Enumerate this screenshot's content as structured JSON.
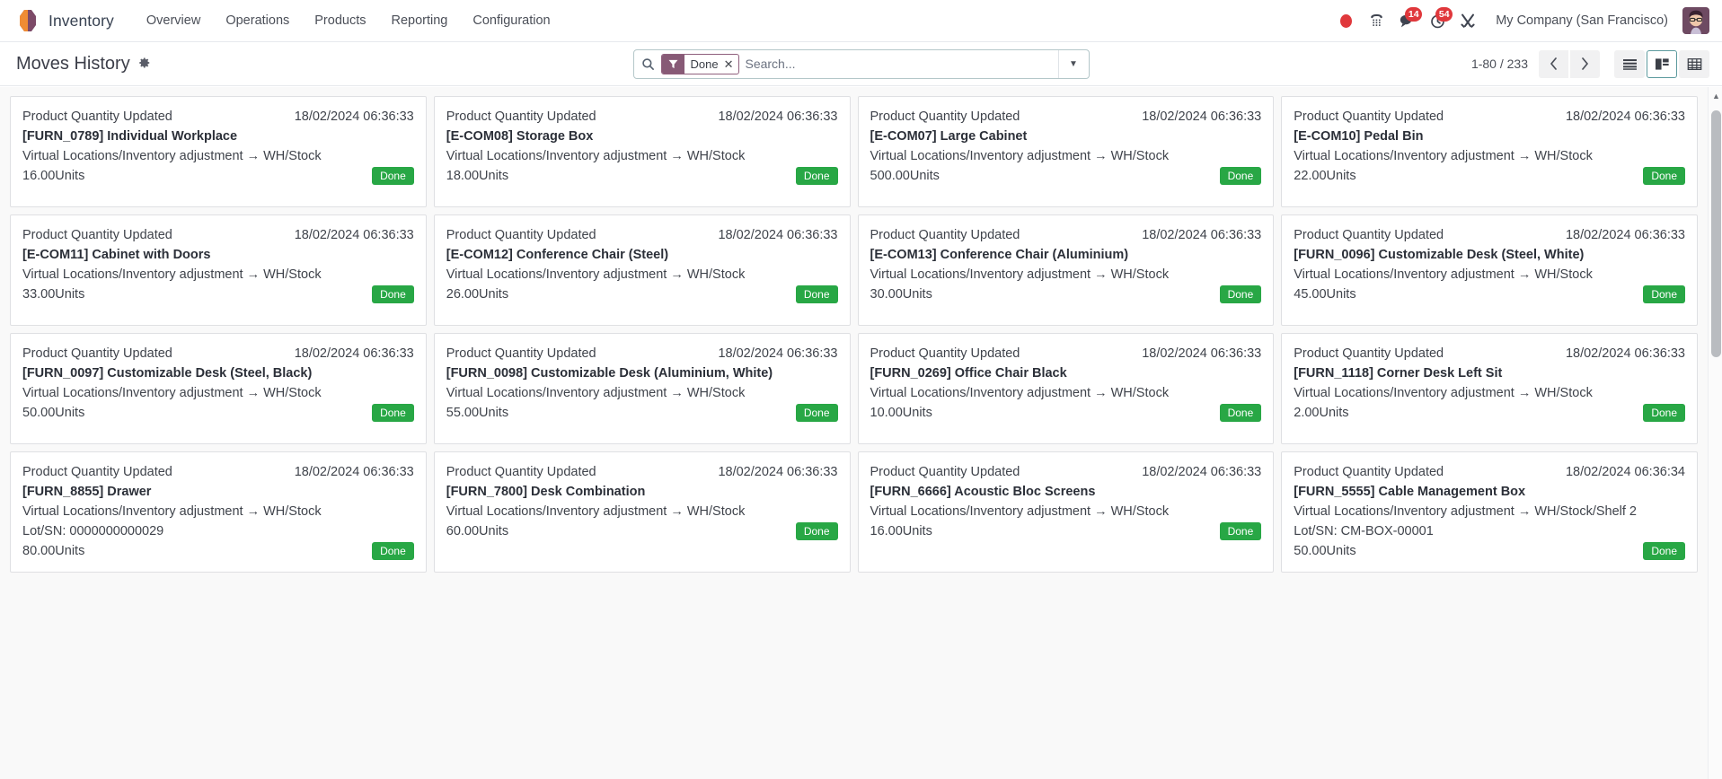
{
  "navbar": {
    "brand": "Inventory",
    "menu": [
      "Overview",
      "Operations",
      "Products",
      "Reporting",
      "Configuration"
    ],
    "icons": {
      "record": "record-dot-icon",
      "phone": "phone-icon",
      "messages": "messages-icon",
      "activities": "clock-icon",
      "debug": "wrench-icon"
    },
    "messages_count": "14",
    "activities_count": "54",
    "company": "My Company (San Francisco)"
  },
  "control_panel": {
    "title": "Moves History",
    "gear": "gear-icon",
    "search": {
      "facet_label": "Done",
      "facet_icon": "filter-icon",
      "placeholder": "Search...",
      "value": ""
    },
    "pager": "1-80 / 233",
    "prev": "‹",
    "next": "›",
    "views": [
      {
        "name": "list",
        "label": "list-view",
        "active": false
      },
      {
        "name": "kanban",
        "label": "kanban-view",
        "active": true
      },
      {
        "name": "pivot",
        "label": "pivot-view",
        "active": false
      }
    ]
  },
  "colors": {
    "accent": "#875A76",
    "badge_done": "#28a745",
    "badge_counter": "#e0383c",
    "kanban_bg": "#f9f9f9"
  },
  "cards": [
    {
      "type": "Product Quantity Updated",
      "date": "18/02/2024 06:36:33",
      "product": "[FURN_0789] Individual Workplace",
      "route": "Virtual Locations/Inventory adjustment → WH/Stock",
      "lot": "",
      "qty": "16.00Units",
      "state": "Done"
    },
    {
      "type": "Product Quantity Updated",
      "date": "18/02/2024 06:36:33",
      "product": "[E-COM08] Storage Box",
      "route": "Virtual Locations/Inventory adjustment → WH/Stock",
      "lot": "",
      "qty": "18.00Units",
      "state": "Done"
    },
    {
      "type": "Product Quantity Updated",
      "date": "18/02/2024 06:36:33",
      "product": "[E-COM07] Large Cabinet",
      "route": "Virtual Locations/Inventory adjustment → WH/Stock",
      "lot": "",
      "qty": "500.00Units",
      "state": "Done"
    },
    {
      "type": "Product Quantity Updated",
      "date": "18/02/2024 06:36:33",
      "product": "[E-COM10] Pedal Bin",
      "route": "Virtual Locations/Inventory adjustment → WH/Stock",
      "lot": "",
      "qty": "22.00Units",
      "state": "Done"
    },
    {
      "type": "Product Quantity Updated",
      "date": "18/02/2024 06:36:33",
      "product": "[E-COM11] Cabinet with Doors",
      "route": "Virtual Locations/Inventory adjustment → WH/Stock",
      "lot": "",
      "qty": "33.00Units",
      "state": "Done"
    },
    {
      "type": "Product Quantity Updated",
      "date": "18/02/2024 06:36:33",
      "product": "[E-COM12] Conference Chair (Steel)",
      "route": "Virtual Locations/Inventory adjustment → WH/Stock",
      "lot": "",
      "qty": "26.00Units",
      "state": "Done"
    },
    {
      "type": "Product Quantity Updated",
      "date": "18/02/2024 06:36:33",
      "product": "[E-COM13] Conference Chair (Aluminium)",
      "route": "Virtual Locations/Inventory adjustment → WH/Stock",
      "lot": "",
      "qty": "30.00Units",
      "state": "Done"
    },
    {
      "type": "Product Quantity Updated",
      "date": "18/02/2024 06:36:33",
      "product": "[FURN_0096] Customizable Desk (Steel, White)",
      "route": "Virtual Locations/Inventory adjustment → WH/Stock",
      "lot": "",
      "qty": "45.00Units",
      "state": "Done"
    },
    {
      "type": "Product Quantity Updated",
      "date": "18/02/2024 06:36:33",
      "product": "[FURN_0097] Customizable Desk (Steel, Black)",
      "route": "Virtual Locations/Inventory adjustment → WH/Stock",
      "lot": "",
      "qty": "50.00Units",
      "state": "Done"
    },
    {
      "type": "Product Quantity Updated",
      "date": "18/02/2024 06:36:33",
      "product": "[FURN_0098] Customizable Desk (Aluminium, White)",
      "route": "Virtual Locations/Inventory adjustment → WH/Stock",
      "lot": "",
      "qty": "55.00Units",
      "state": "Done"
    },
    {
      "type": "Product Quantity Updated",
      "date": "18/02/2024 06:36:33",
      "product": "[FURN_0269] Office Chair Black",
      "route": "Virtual Locations/Inventory adjustment → WH/Stock",
      "lot": "",
      "qty": "10.00Units",
      "state": "Done"
    },
    {
      "type": "Product Quantity Updated",
      "date": "18/02/2024 06:36:33",
      "product": "[FURN_1118] Corner Desk Left Sit",
      "route": "Virtual Locations/Inventory adjustment → WH/Stock",
      "lot": "",
      "qty": "2.00Units",
      "state": "Done"
    },
    {
      "type": "Product Quantity Updated",
      "date": "18/02/2024 06:36:33",
      "product": "[FURN_8855] Drawer",
      "route": "Virtual Locations/Inventory adjustment → WH/Stock",
      "lot": "Lot/SN: 0000000000029",
      "qty": "80.00Units",
      "state": "Done"
    },
    {
      "type": "Product Quantity Updated",
      "date": "18/02/2024 06:36:33",
      "product": "[FURN_7800] Desk Combination",
      "route": "Virtual Locations/Inventory adjustment → WH/Stock",
      "lot": "",
      "qty": "60.00Units",
      "state": "Done"
    },
    {
      "type": "Product Quantity Updated",
      "date": "18/02/2024 06:36:33",
      "product": "[FURN_6666] Acoustic Bloc Screens",
      "route": "Virtual Locations/Inventory adjustment → WH/Stock",
      "lot": "",
      "qty": "16.00Units",
      "state": "Done"
    },
    {
      "type": "Product Quantity Updated",
      "date": "18/02/2024 06:36:34",
      "product": "[FURN_5555] Cable Management Box",
      "route": "Virtual Locations/Inventory adjustment → WH/Stock/Shelf 2",
      "lot": "Lot/SN: CM-BOX-00001",
      "qty": "50.00Units",
      "state": "Done"
    }
  ]
}
